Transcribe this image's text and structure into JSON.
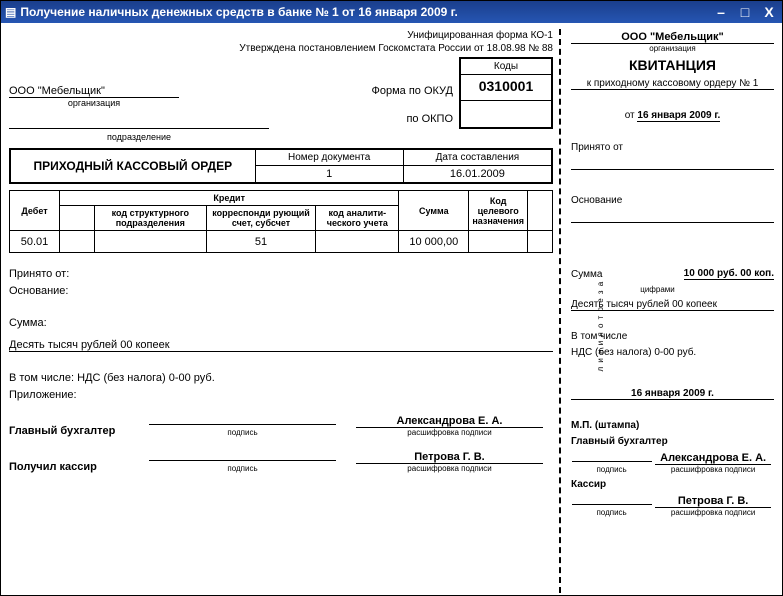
{
  "window": {
    "title": "Получение наличных денежных средств в банке № 1 от 16 января 2009 г.",
    "minimize": "–",
    "maximize": "□",
    "close": "X"
  },
  "left": {
    "form_name": "Унифицированная форма КО-1",
    "approved": "Утверждена постановлением Госкомстата России от 18.08.98 № 88",
    "codes_header": "Коды",
    "okud_label": "Форма по ОКУД",
    "okud_value": "0310001",
    "okpo_label": "по ОКПО",
    "okpo_value": "",
    "org_name": "ООО \"Мебельщик\"",
    "org_caption": "организация",
    "division_caption": "подразделение",
    "doc_title": "ПРИХОДНЫЙ КАССОВЫЙ ОРДЕР",
    "doc_num_label": "Номер документа",
    "doc_num_value": "1",
    "doc_date_label": "Дата составления",
    "doc_date_value": "16.01.2009",
    "credit_header": "Кредит",
    "th_debit": "Дебет",
    "th_struct": "код структурного подразделения",
    "th_corr": "корреспонди рующий счет, субсчет",
    "th_anal": "код аналити- ческого учета",
    "th_sum": "Сумма",
    "th_target": "Код целевого назначения",
    "row": {
      "debit": "50.01",
      "struct": "",
      "corr": "51",
      "anal": "",
      "sum": "10 000,00",
      "target": ""
    },
    "received_from_label": "Принято от:",
    "basis_label": "Основание:",
    "sum_label": "Сумма:",
    "sum_words": "Десять тысяч рублей 00 копеек",
    "incl_label": "В том числе: НДС (без налога) 0-00 руб.",
    "attachment_label": "Приложение:",
    "chief_acc": "Главный бухгалтер",
    "chief_name": "Александрова Е. А.",
    "cashier": "Получил кассир",
    "cashier_name": "Петрова Г. В.",
    "sig_caption": "подпись",
    "name_caption": "расшифровка подписи"
  },
  "right": {
    "cut": "л и н и я   о т р е з а",
    "org_name": "ООО \"Мебельщик\"",
    "org_caption": "организация",
    "title": "КВИТАНЦИЯ",
    "to_order": "к приходному кассовому ордеру № 1",
    "date_prefix": "от",
    "date": "16 января 2009 г.",
    "received_from": "Принято от",
    "basis": "Основание",
    "sum_label": "Сумма",
    "sum_value": "10 000 руб. 00 коп.",
    "sum_caption": "цифрами",
    "sum_words": "Десять тысяч рублей 00 копеек",
    "incl1": "В том числе",
    "incl2": "НДС (без налога) 0-00 руб.",
    "date2": "16 января 2009 г.",
    "stamp": "М.П. (штампа)",
    "chief_acc": "Главный бухгалтер",
    "chief_name": "Александрова Е. А.",
    "cashier": "Кассир",
    "cashier_name": "Петрова Г. В.",
    "sig_caption": "подпись",
    "name_caption": "расшифровка подписи"
  }
}
